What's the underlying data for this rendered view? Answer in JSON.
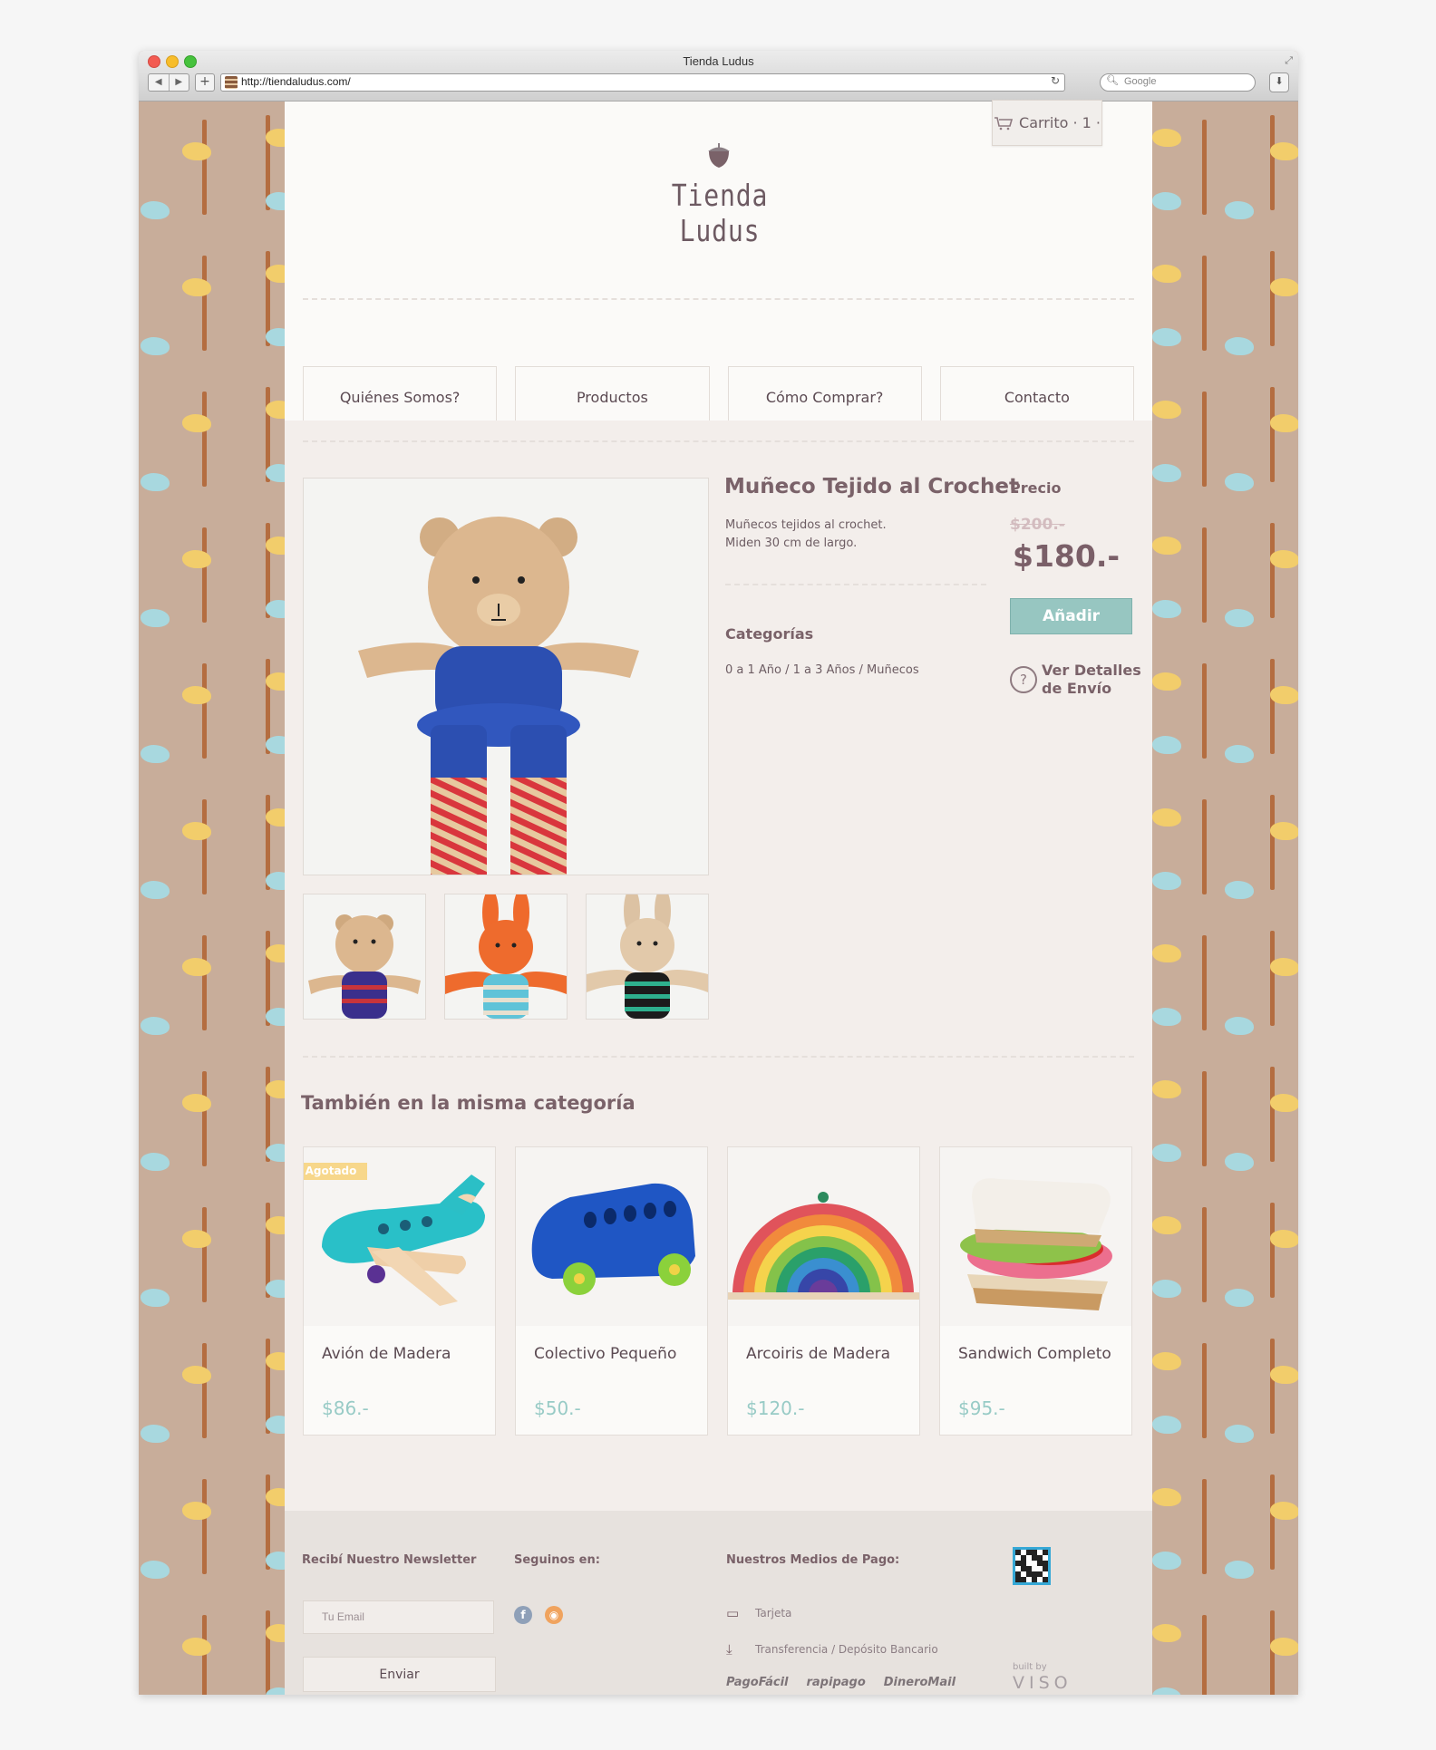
{
  "browser": {
    "window_title": "Tienda Ludus",
    "url": "http://tiendaludus.com/",
    "search_placeholder": "Google"
  },
  "header": {
    "cart_label": "Carrito · 1 ·",
    "logo_text": "Tienda Ludus"
  },
  "nav": {
    "items": [
      "Quiénes Somos?",
      "Productos",
      "Cómo Comprar?",
      "Contacto"
    ]
  },
  "product": {
    "title": "Muñeco Tejido al Crochet",
    "description_line1": "Muñecos tejidos al crochet.",
    "description_line2": "Miden 30 cm de largo.",
    "categories_heading": "Categorías",
    "categories_value": "0 a 1 Año / 1 a 3 Años / Muñecos",
    "price_heading": "Precio",
    "old_price": "$200.-",
    "new_price": "$180.-",
    "add_button": "Añadir",
    "shipping_link": "Ver Detalles de Envío"
  },
  "related": {
    "heading": "También en la misma categoría",
    "badge": "Agotado",
    "items": [
      {
        "name": "Avión de Madera",
        "price": "$86.-"
      },
      {
        "name": "Colectivo Pequeño",
        "price": "$50.-"
      },
      {
        "name": "Arcoiris de Madera",
        "price": "$120.-"
      },
      {
        "name": "Sandwich Completo",
        "price": "$95.-"
      }
    ]
  },
  "footer": {
    "newsletter_heading": "Recibí Nuestro Newsletter",
    "email_placeholder": "Tu Email",
    "send_button": "Enviar",
    "follow_heading": "Seguinos en:",
    "payment_heading": "Nuestros Medios de Pago:",
    "payment_card": "Tarjeta",
    "payment_transfer": "Transferencia / Depósito Bancario",
    "payment_logos": [
      "PagoFácil",
      "rapipago",
      "DineroMail"
    ],
    "built_by": "built by",
    "builder": "VISO"
  },
  "colors": {
    "background_pattern": "#c8ad9a",
    "accent_teal": "#97c6c1",
    "text_mauve": "#7a6269",
    "badge_yellow": "#f7d78b"
  },
  "icons": [
    "cart-icon",
    "acorn-logo-icon",
    "help-icon",
    "facebook-icon",
    "rss-icon",
    "card-icon",
    "transfer-icon",
    "qr-data-fiscal-icon"
  ]
}
